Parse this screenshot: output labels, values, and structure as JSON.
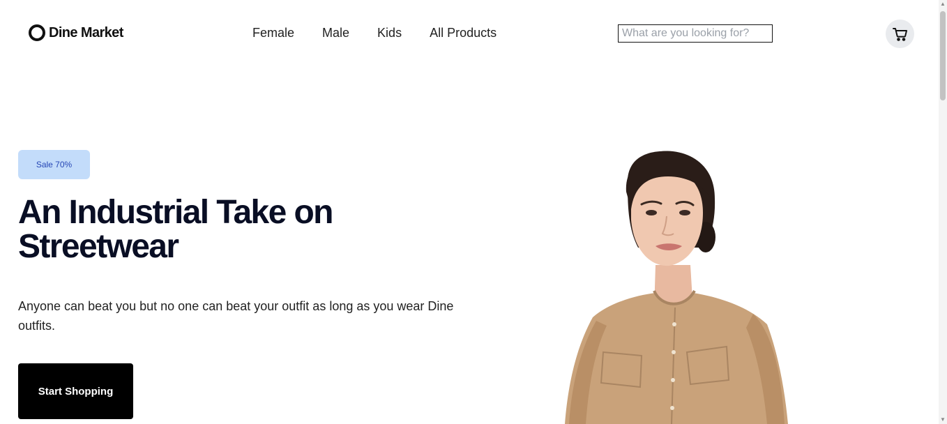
{
  "brand": {
    "name": "Dine Market"
  },
  "nav": {
    "links": [
      "Female",
      "Male",
      "Kids",
      "All Products"
    ]
  },
  "search": {
    "placeholder": "What are you looking for?",
    "value": ""
  },
  "cart": {
    "icon": "cart-icon"
  },
  "hero": {
    "badge": "Sale 70%",
    "title": "An Industrial Take on Streetwear",
    "description": "Anyone can beat you but no one can beat your outfit as long as you wear Dine outfits.",
    "cta_label": "Start Shopping"
  },
  "colors": {
    "badge_bg": "#c3dcfa",
    "badge_text": "#2546b5",
    "title": "#090e24",
    "cta_bg": "#000000",
    "cart_bg": "#e9ebee",
    "shirt": "#c9a27a"
  }
}
